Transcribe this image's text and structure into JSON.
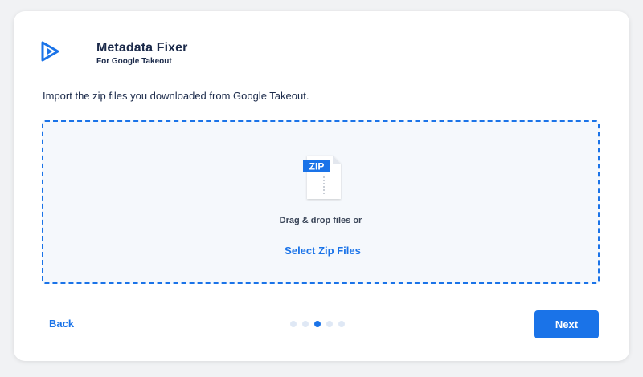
{
  "app": {
    "title": "Metadata Fixer",
    "subtitle": "For Google Takeout",
    "logo_icon": "play-logo-icon"
  },
  "main": {
    "instruction": "Import the zip files you downloaded from Google Takeout.",
    "dropzone": {
      "icon": "zip-file-icon",
      "icon_label": "ZIP",
      "drop_text": "Drag & drop files or",
      "select_label": "Select Zip Files"
    }
  },
  "footer": {
    "back_label": "Back",
    "next_label": "Next",
    "step_indicator": {
      "total_steps": 5,
      "current_step": 3
    }
  },
  "colors": {
    "accent": "#1a73e8",
    "title_text": "#1b2a4a",
    "dropzone_background": "#f5f8fc",
    "inactive_dot": "#dfe8f5"
  }
}
